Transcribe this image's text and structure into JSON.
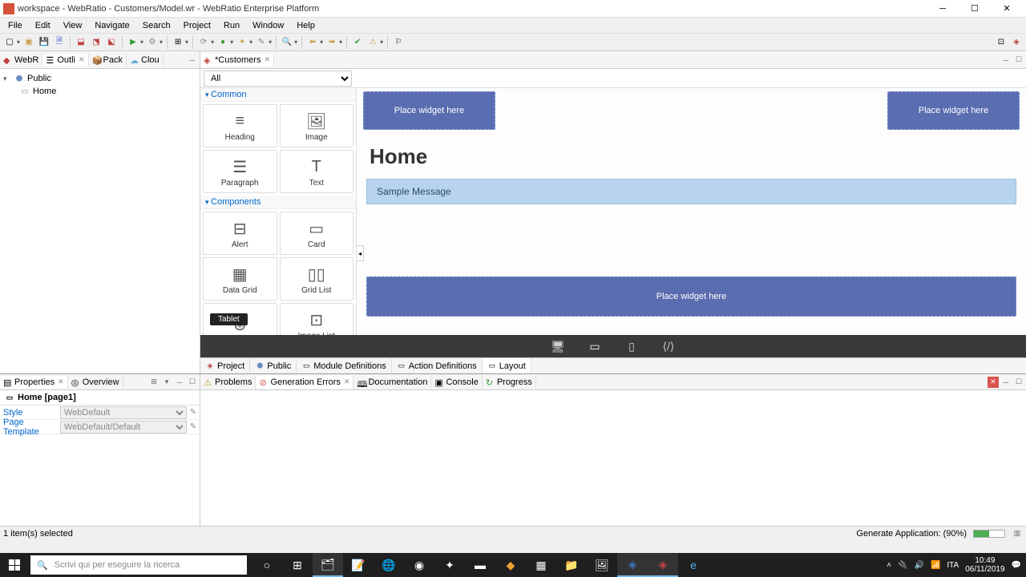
{
  "titlebar": {
    "text": "workspace - WebRatio - Customers/Model.wr - WebRatio Enterprise Platform"
  },
  "menu": [
    "File",
    "Edit",
    "View",
    "Navigate",
    "Search",
    "Project",
    "Run",
    "Window",
    "Help"
  ],
  "leftTabs": [
    "WebR",
    "Outli",
    "Pack",
    "Clou"
  ],
  "tree": {
    "root": "Public",
    "child": "Home"
  },
  "editor": {
    "tab": "*Customers",
    "paletteFilter": "All",
    "sections": {
      "common": "Common",
      "components": "Components"
    },
    "palette": {
      "heading": "Heading",
      "image": "Image",
      "paragraph": "Paragraph",
      "text": "Text",
      "alert": "Alert",
      "card": "Card",
      "datagrid": "Data Grid",
      "gridlist": "Grid List",
      "iconlist": "",
      "imagelist": "Image List"
    },
    "tooltip": "Tablet"
  },
  "canvas": {
    "dropLeft": "Place widget here",
    "dropRight": "Place widget here",
    "title": "Home",
    "sample": "Sample Message",
    "dropBottom": "Place widget here"
  },
  "bottomTabs": [
    "Project",
    "Public",
    "Module Definitions",
    "Action Definitions",
    "Layout"
  ],
  "properties": {
    "tabs": [
      "Properties",
      "Overview"
    ],
    "header": "Home [page1]",
    "rows": [
      {
        "key": "Style",
        "val": "WebDefault"
      },
      {
        "key": "Page Template",
        "val": "WebDefault/Default"
      }
    ]
  },
  "bottomRight": {
    "tabs": [
      "Problems",
      "Generation Errors",
      "Documentation",
      "Console",
      "Progress"
    ]
  },
  "status": {
    "left": "1 item(s) selected",
    "right": "Generate Application: (90%)"
  },
  "taskbar": {
    "search": "Scrivi qui per eseguire la ricerca",
    "lang": "ITA",
    "time": "10:49",
    "date": "06/11/2019"
  }
}
